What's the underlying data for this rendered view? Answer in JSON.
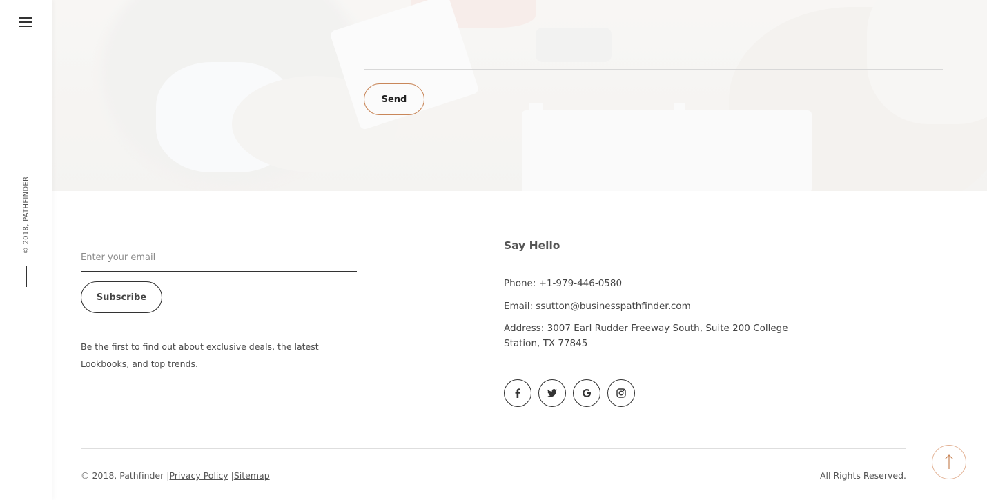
{
  "sidebar": {
    "menu_icon": "hamburger-icon",
    "copyright_vertical": "© 2018, PATHFINDER"
  },
  "hero": {
    "send_label": "Send"
  },
  "newsletter": {
    "email_placeholder": "Enter your email",
    "subscribe_label": "Subscribe",
    "promo_text": "Be the first to find out about exclusive deals, the latest Lookbooks, and top trends."
  },
  "contact": {
    "heading": "Say Hello",
    "phone": "Phone: +1-979-446-0580",
    "email": "Email: ssutton@businesspathfinder.com",
    "address": "Address: 3007 Earl Rudder Freeway South, Suite 200 College Station, TX 77845"
  },
  "socials": [
    {
      "icon": "facebook-icon"
    },
    {
      "icon": "twitter-icon"
    },
    {
      "icon": "google-icon"
    },
    {
      "icon": "instagram-icon"
    }
  ],
  "footer": {
    "copyright": "© 2018, Pathfinder",
    "separator": "|",
    "privacy_label": "Privacy Policy",
    "sitemap_label": "Sitemap",
    "rights": "All Rights Reserved."
  },
  "colors": {
    "accent": "#c9875a",
    "text": "#555555"
  }
}
